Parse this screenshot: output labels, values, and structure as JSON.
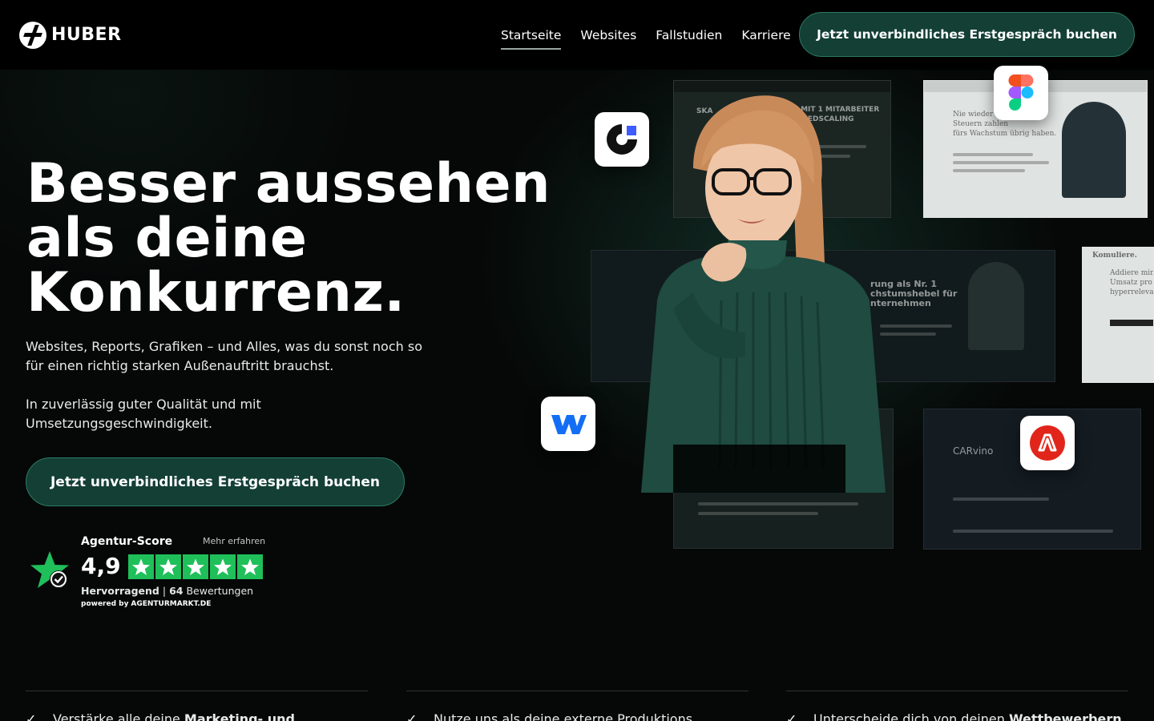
{
  "brand": {
    "name": "HUBER"
  },
  "nav": {
    "items": [
      {
        "label": "Startseite",
        "active": true
      },
      {
        "label": "Websites",
        "active": false
      },
      {
        "label": "Fallstudien",
        "active": false
      },
      {
        "label": "Karriere",
        "active": false
      }
    ],
    "cta": "Jetzt unverbindliches Erstgespräch buchen"
  },
  "hero": {
    "title_lines": [
      "Besser aussehen",
      "als deine",
      "Konkurrenz."
    ],
    "subtitle": "Websites, Reports, Grafiken – und Alles,  was du sonst noch so für einen richtig starken Außenauftritt brauchst.",
    "subtitle2": "In zuverlässig guter Qualität und mit Umsetzungsgeschwindigkeit.",
    "cta": "Jetzt unverbindliches Erstgespräch buchen"
  },
  "rating": {
    "title": "Agentur-Score",
    "more": "Mehr erfahren",
    "score": "4,9",
    "stars": 5,
    "verdict": "Hervorragend",
    "count": "64",
    "count_label": "Bewertungen",
    "powered_prefix": "powered by",
    "powered_brand": "AGENTURMARKT.DE",
    "star_color": "#1fbf5a"
  },
  "mockups": {
    "top_center_text": "NAT MIT 1 MITARBEITER\nIT SPEEDSCALING",
    "top_center_left": "SKA",
    "mid_right_text": "rung als Nr. 1\nchstumshebel für\nnternehmen",
    "far_right_text": "Addiere mind\nUmsatz pro M\nhyperrelevan",
    "far_right_head": "Komuliere.",
    "light_text": "Nie wieder van\nSteuern zahlen\nfürs Wachstum übrig haben.",
    "bottom_brand": "CARvino"
  },
  "app_icons": [
    "cargo-icon",
    "figma-icon",
    "webflow-icon",
    "adobe-icon"
  ],
  "features": [
    {
      "prefix": "Verstärke alle deine ",
      "bold": "Marketing- und"
    },
    {
      "prefix": "Nutze uns als deine externe Produktions",
      "bold": ""
    },
    {
      "prefix": "Unterscheide dich von deinen ",
      "bold": "Wettbewerbern"
    }
  ],
  "colors": {
    "accent": "#133f34",
    "accent_border": "#2d7a66",
    "background": "#050807"
  }
}
